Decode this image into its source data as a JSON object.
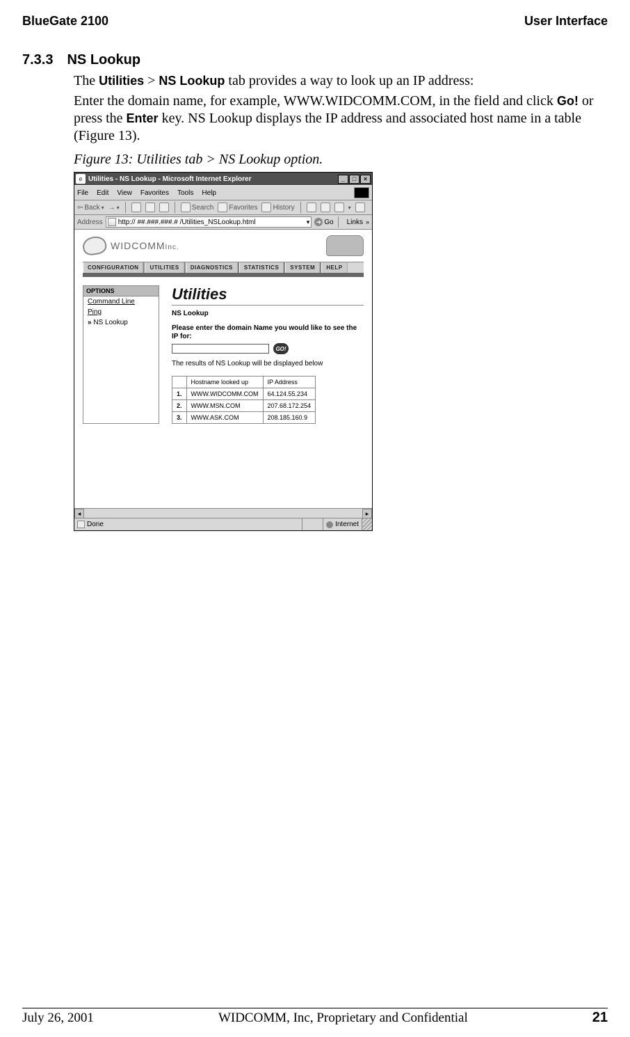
{
  "header": {
    "left": "BlueGate 2100",
    "right": "User Interface"
  },
  "section": {
    "number": "7.3.3",
    "title": "NS Lookup"
  },
  "para1_parts": {
    "a": "The ",
    "b": "Utilities",
    "c": " > ",
    "d": "NS Lookup",
    "e": " tab provides a way to look up an IP address:"
  },
  "para2_parts": {
    "a": "Enter the domain name, for example, WWW.WIDCOMM.COM, in the field and click ",
    "b": "Go!",
    "c": " or press the ",
    "d": "Enter",
    "e": " key. NS Lookup displays the IP address and associated host name in a table (Figure 13)."
  },
  "figure_caption": "Figure 13:  Utilities tab > NS Lookup option.",
  "window": {
    "title": "Utilities - NS Lookup - Microsoft Internet Explorer",
    "menus": [
      "File",
      "Edit",
      "View",
      "Favorites",
      "Tools",
      "Help"
    ],
    "toolbar": {
      "back": "Back",
      "search": "Search",
      "favorites": "Favorites",
      "history": "History"
    },
    "address_label": "Address",
    "address_value": "http:// ##.###.###.# /Utilities_NSLookup.html",
    "go_label": "Go",
    "links_label": "Links"
  },
  "brand": {
    "name": "WIDCOMM",
    "suffix": "Inc."
  },
  "tabs": [
    "Configuration",
    "Utilities",
    "Diagnostics",
    "Statistics",
    "System",
    "Help"
  ],
  "options": {
    "title": "OPTIONS",
    "items": [
      "Command Line",
      "Ping",
      "NS Lookup"
    ],
    "active_index": 2
  },
  "panel": {
    "heading": "Utilities",
    "sub": "NS Lookup",
    "prompt": "Please enter the domain Name you would like to see the IP for:",
    "go": "GO!",
    "result_note": "The results of NS Lookup will be displayed below",
    "table": {
      "headers": [
        "",
        "Hostname looked up",
        "IP Address"
      ],
      "rows": [
        {
          "n": "1.",
          "host": "WWW.WIDCOMM.COM",
          "ip": "64.124.55.234"
        },
        {
          "n": "2.",
          "host": "WWW.MSN.COM",
          "ip": "207.68.172.254"
        },
        {
          "n": "3.",
          "host": "WWW.ASK.COM",
          "ip": "208.185.160.9"
        }
      ]
    }
  },
  "statusbar": {
    "done": "Done",
    "zone": "Internet"
  },
  "footer": {
    "date": "July 26, 2001",
    "mid": "WIDCOMM, Inc, Proprietary and Confidential",
    "page": "21"
  }
}
